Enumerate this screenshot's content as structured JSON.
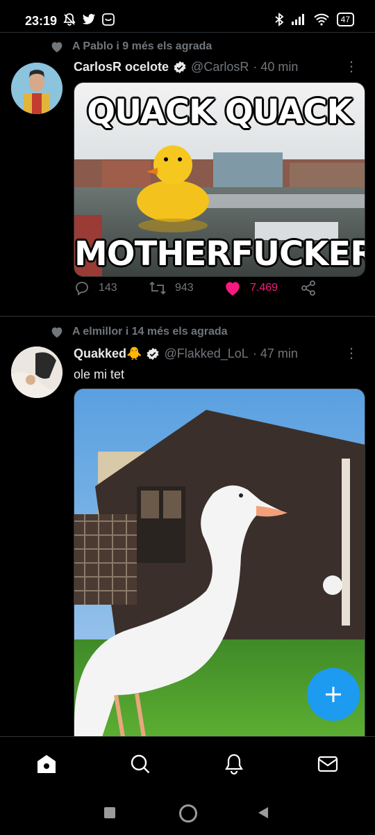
{
  "status_bar": {
    "time": "23:19",
    "battery": "47"
  },
  "tweets": [
    {
      "social_context": "A Pablo i 9 més els agrada",
      "name": "CarlosR ocelote",
      "handle": "@CarlosR",
      "time": "· 40 min",
      "media": {
        "top_text": "QUACK QUACK",
        "bottom_text": "MOTHERFUCKER"
      },
      "actions": {
        "replies": "143",
        "retweets": "943",
        "likes": "7.469",
        "liked": true
      }
    },
    {
      "social_context": "A elmillor i 14 més els agrada",
      "name": "Quakked",
      "name_emoji": "🐥",
      "handle": "@Flakked_LoL",
      "time": "· 47 min",
      "text": "ole mi tet"
    }
  ],
  "icons": {
    "heart": "heart-icon",
    "verified": "verified-badge-icon",
    "reply": "reply-icon",
    "retweet": "retweet-icon",
    "like": "like-icon",
    "share": "share-icon",
    "compose": "plus-icon",
    "home": "home-icon",
    "search": "search-icon",
    "notifications": "bell-icon",
    "messages": "mail-icon"
  },
  "colors": {
    "accent": "#1d9bf0",
    "like": "#f91880",
    "muted": "#71767b",
    "background": "#000000"
  }
}
